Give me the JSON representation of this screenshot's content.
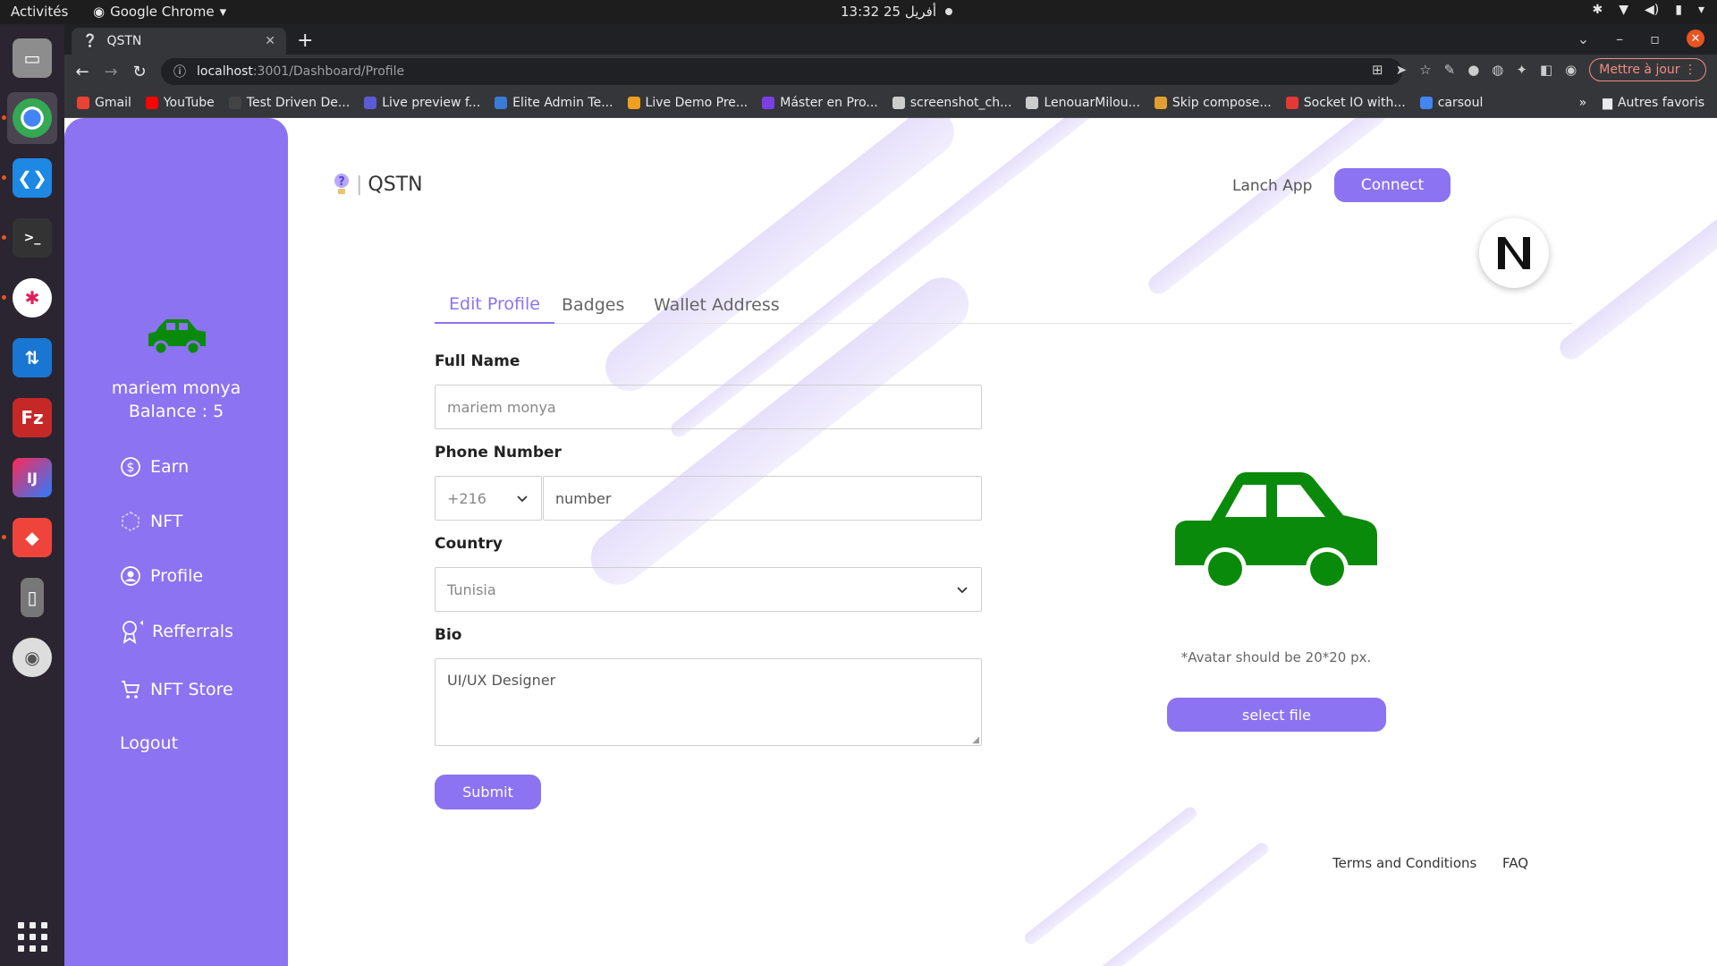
{
  "os": {
    "activities": "Activités",
    "app_name": "Google Chrome",
    "clock": "13:32  25 أفريل"
  },
  "browser": {
    "tab_title": "QSTN",
    "url_host": "localhost",
    "url_path": ":3001/Dashboard/Profile",
    "update_button": "Mettre à jour",
    "bookmarks": [
      {
        "label": "Gmail",
        "color": "#ea4335"
      },
      {
        "label": "YouTube",
        "color": "#ff0000"
      },
      {
        "label": "Test Driven De...",
        "color": "#444444"
      },
      {
        "label": "Live preview f...",
        "color": "#5b5bd6"
      },
      {
        "label": "Elite Admin Te...",
        "color": "#3a7bd5"
      },
      {
        "label": "Live Demo Pre...",
        "color": "#f0a020"
      },
      {
        "label": "Máster en Pro...",
        "color": "#7b3fe4"
      },
      {
        "label": "screenshot_ch...",
        "color": "#cccccc"
      },
      {
        "label": "LenouarMilou...",
        "color": "#cccccc"
      },
      {
        "label": "Skip compose...",
        "color": "#e0a030"
      },
      {
        "label": "Socket IO with...",
        "color": "#e53935"
      },
      {
        "label": "carsoul",
        "color": "#4285f4"
      }
    ],
    "other_bookmarks": "Autres favoris"
  },
  "sidebar": {
    "user_name": "mariem monya",
    "balance": "Balance : 5",
    "items": [
      {
        "label": "Earn",
        "icon": "dollar-icon"
      },
      {
        "label": "NFT",
        "icon": "nft-icon"
      },
      {
        "label": "Profile",
        "icon": "user-icon"
      },
      {
        "label": "Refferrals",
        "icon": "award-icon"
      },
      {
        "label": "NFT Store",
        "icon": "cart-icon"
      },
      {
        "label": "Logout",
        "icon": ""
      }
    ]
  },
  "header": {
    "brand": "QSTN",
    "launch_app": "Lanch App",
    "connect": "Connect"
  },
  "tabs": [
    "Edit Profile",
    "Badges",
    "Wallet Address"
  ],
  "form": {
    "full_name_label": "Full Name",
    "full_name_placeholder": "mariem monya",
    "phone_label": "Phone Number",
    "phone_code": "+216",
    "phone_placeholder": "number",
    "country_label": "Country",
    "country_value": "Tunisia",
    "bio_label": "Bio",
    "bio_value": "UI/UX Designer",
    "submit": "Submit"
  },
  "avatar": {
    "hint": "*Avatar should be 20*20 px.",
    "select_file": "select file"
  },
  "footer": {
    "terms": "Terms and Conditions",
    "faq": "FAQ"
  },
  "colors": {
    "accent": "#8b73f1",
    "avatar_green": "#0a8a0a"
  }
}
